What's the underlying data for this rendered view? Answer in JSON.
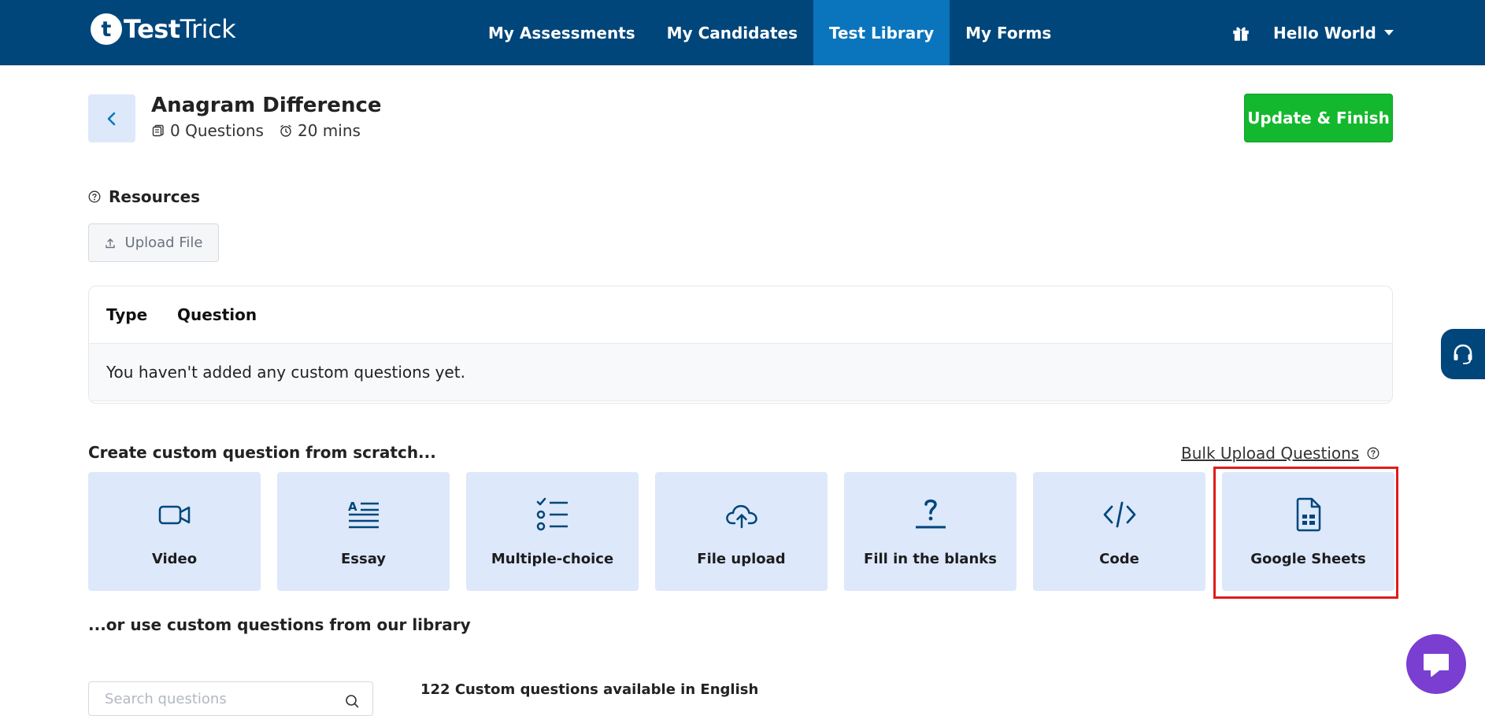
{
  "nav": {
    "logo_initial": "t",
    "logo_bold": "Test",
    "logo_light": "Trick",
    "links": [
      {
        "label": "My Assessments"
      },
      {
        "label": "My Candidates"
      },
      {
        "label": "Test Library",
        "active": true
      },
      {
        "label": "My Forms"
      }
    ],
    "user_label": "Hello World"
  },
  "header": {
    "title": "Anagram Difference",
    "questions": "0 Questions",
    "duration": "20 mins",
    "update_button": "Update & Finish"
  },
  "resources": {
    "title": "Resources",
    "upload_label": "Upload File"
  },
  "table": {
    "col_type": "Type",
    "col_question": "Question",
    "empty_message": "You haven't added any custom questions yet."
  },
  "create": {
    "title": "Create custom question from scratch...",
    "bulk_link": "Bulk Upload Questions",
    "cards": [
      {
        "label": "Video",
        "icon": "video-icon"
      },
      {
        "label": "Essay",
        "icon": "essay-icon"
      },
      {
        "label": "Multiple-choice",
        "icon": "multiple-choice-icon"
      },
      {
        "label": "File upload",
        "icon": "cloud-upload-icon"
      },
      {
        "label": "Fill in the blanks",
        "icon": "fill-blank-icon"
      },
      {
        "label": "Code",
        "icon": "code-icon"
      },
      {
        "label": "Google Sheets",
        "icon": "spreadsheet-icon"
      }
    ]
  },
  "library": {
    "title": "...or use custom questions from our library",
    "search_placeholder": "Search questions",
    "count_text": "122 Custom questions available in English"
  },
  "colors": {
    "nav_bg": "#00467a",
    "nav_active": "#0a75bd",
    "card_bg": "#dde8fa",
    "primary_green": "#14b82e",
    "highlight_red": "#e01b1b",
    "chat_purple": "#7a3ed1"
  }
}
